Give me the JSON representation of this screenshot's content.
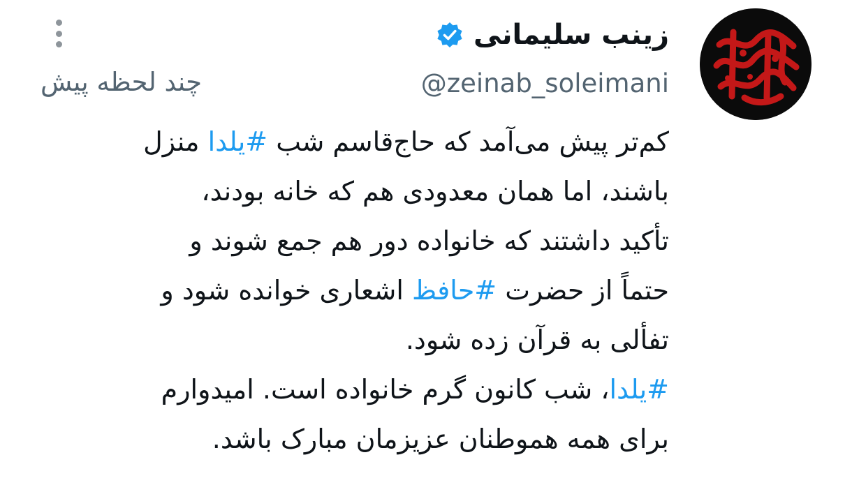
{
  "author": {
    "display_name": "زینب سلیمانی",
    "handle": "@zeinab_soleimani",
    "verified": true,
    "verified_badge_icon": "verified-badge-icon",
    "avatar_icon": "calligraphy-avatar-icon"
  },
  "tweet": {
    "timestamp": "چند لحظه پیش",
    "more_menu_icon": "more-vertical-icon",
    "lines": [
      {
        "segments": [
          {
            "text": "کم‌تر پیش می‌آمد که حاج‌قاسم شب ",
            "hashtag": false
          },
          {
            "text": "#یلدا",
            "hashtag": true
          },
          {
            "text": " منزل",
            "hashtag": false
          }
        ]
      },
      {
        "segments": [
          {
            "text": "باشند، اما همان معدودی هم که خانه بودند،",
            "hashtag": false
          }
        ]
      },
      {
        "segments": [
          {
            "text": "تأکید داشتند که خانواده دور هم جمع شوند و",
            "hashtag": false
          }
        ]
      },
      {
        "segments": [
          {
            "text": "حتماً از حضرت ",
            "hashtag": false
          },
          {
            "text": "#حافظ",
            "hashtag": true
          },
          {
            "text": " اشعاری خوانده شود و",
            "hashtag": false
          }
        ]
      },
      {
        "segments": [
          {
            "text": "تفألی به قرآن زده شود.",
            "hashtag": false
          }
        ]
      },
      {
        "segments": [
          {
            "text": "#یلدا",
            "hashtag": true
          },
          {
            "text": "، شب کانون گرم خانواده است. امیدوارم",
            "hashtag": false
          }
        ]
      },
      {
        "segments": [
          {
            "text": "برای همه هموطنان عزیزمان مبارک باشد.",
            "hashtag": false
          }
        ]
      }
    ]
  },
  "colors": {
    "text": "#0f1419",
    "secondary": "#536471",
    "hashtag": "#1d9bf0",
    "verified": "#1d9bf0",
    "avatar_bg": "#0b0b0b",
    "avatar_calligraphy": "#c41818"
  }
}
